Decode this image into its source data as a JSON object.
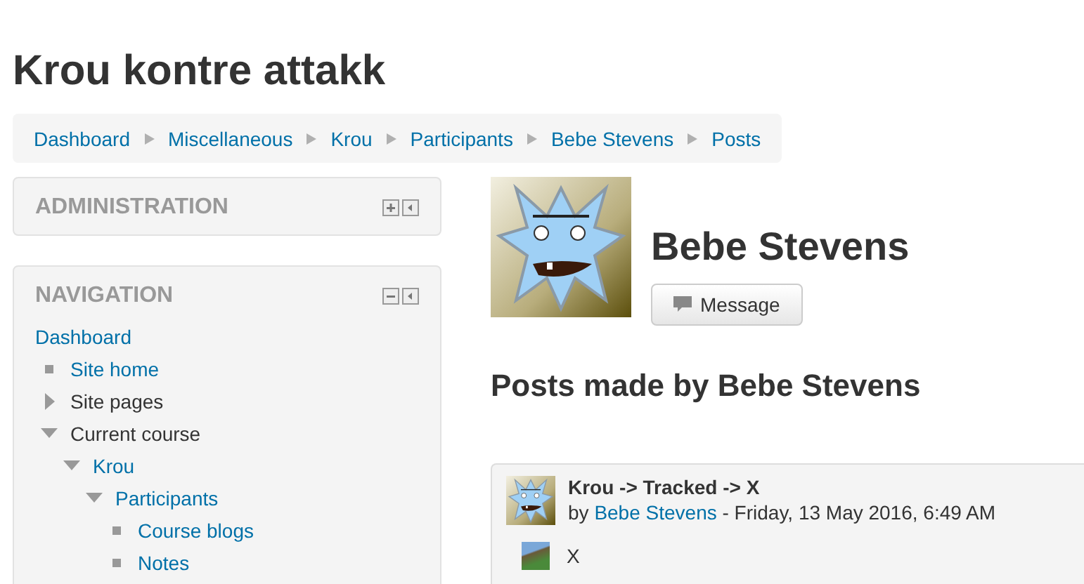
{
  "page_title": "Krou kontre attakk",
  "breadcrumb": [
    "Dashboard",
    "Miscellaneous",
    "Krou",
    "Participants",
    "Bebe Stevens",
    "Posts"
  ],
  "blocks": [
    {
      "title": "ADMINISTRATION",
      "expanded": false
    },
    {
      "title": "NAVIGATION",
      "expanded": true,
      "items": [
        {
          "label": "Dashboard",
          "kind": "root",
          "link": true
        },
        {
          "label": "Site home",
          "kind": "leaf",
          "link": true
        },
        {
          "label": "Site pages",
          "kind": "branch",
          "link": false,
          "expanded": false
        },
        {
          "label": "Current course",
          "kind": "branch",
          "link": false,
          "expanded": true,
          "children": [
            {
              "label": "Krou",
              "kind": "branch",
              "link": true,
              "expanded": true,
              "children": [
                {
                  "label": "Participants",
                  "kind": "branch",
                  "link": true,
                  "expanded": true,
                  "children": [
                    {
                      "label": "Course blogs",
                      "kind": "leaf",
                      "link": true
                    },
                    {
                      "label": "Notes",
                      "kind": "leaf",
                      "link": true
                    }
                  ]
                }
              ]
            }
          ]
        }
      ]
    }
  ],
  "profile": {
    "name": "Bebe Stevens",
    "message_button": "Message"
  },
  "posts_heading": "Posts made by Bebe Stevens",
  "posts": [
    {
      "subject": "Krou -> Tracked -> X",
      "by": "by",
      "author": "Bebe Stevens",
      "date": "- Friday, 13 May 2016, 6:49 AM",
      "body": "X"
    }
  ]
}
